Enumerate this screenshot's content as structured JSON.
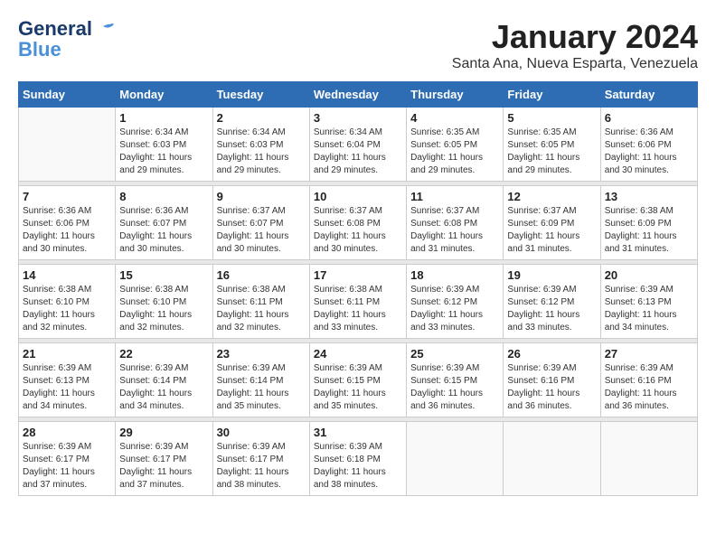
{
  "logo": {
    "line1": "General",
    "line2": "Blue"
  },
  "title": "January 2024",
  "subtitle": "Santa Ana, Nueva Esparta, Venezuela",
  "days_of_week": [
    "Sunday",
    "Monday",
    "Tuesday",
    "Wednesday",
    "Thursday",
    "Friday",
    "Saturday"
  ],
  "weeks": [
    [
      {
        "day": "",
        "info": ""
      },
      {
        "day": "1",
        "info": "Sunrise: 6:34 AM\nSunset: 6:03 PM\nDaylight: 11 hours\nand 29 minutes."
      },
      {
        "day": "2",
        "info": "Sunrise: 6:34 AM\nSunset: 6:03 PM\nDaylight: 11 hours\nand 29 minutes."
      },
      {
        "day": "3",
        "info": "Sunrise: 6:34 AM\nSunset: 6:04 PM\nDaylight: 11 hours\nand 29 minutes."
      },
      {
        "day": "4",
        "info": "Sunrise: 6:35 AM\nSunset: 6:05 PM\nDaylight: 11 hours\nand 29 minutes."
      },
      {
        "day": "5",
        "info": "Sunrise: 6:35 AM\nSunset: 6:05 PM\nDaylight: 11 hours\nand 29 minutes."
      },
      {
        "day": "6",
        "info": "Sunrise: 6:36 AM\nSunset: 6:06 PM\nDaylight: 11 hours\nand 30 minutes."
      }
    ],
    [
      {
        "day": "7",
        "info": "Sunrise: 6:36 AM\nSunset: 6:06 PM\nDaylight: 11 hours\nand 30 minutes."
      },
      {
        "day": "8",
        "info": "Sunrise: 6:36 AM\nSunset: 6:07 PM\nDaylight: 11 hours\nand 30 minutes."
      },
      {
        "day": "9",
        "info": "Sunrise: 6:37 AM\nSunset: 6:07 PM\nDaylight: 11 hours\nand 30 minutes."
      },
      {
        "day": "10",
        "info": "Sunrise: 6:37 AM\nSunset: 6:08 PM\nDaylight: 11 hours\nand 30 minutes."
      },
      {
        "day": "11",
        "info": "Sunrise: 6:37 AM\nSunset: 6:08 PM\nDaylight: 11 hours\nand 31 minutes."
      },
      {
        "day": "12",
        "info": "Sunrise: 6:37 AM\nSunset: 6:09 PM\nDaylight: 11 hours\nand 31 minutes."
      },
      {
        "day": "13",
        "info": "Sunrise: 6:38 AM\nSunset: 6:09 PM\nDaylight: 11 hours\nand 31 minutes."
      }
    ],
    [
      {
        "day": "14",
        "info": "Sunrise: 6:38 AM\nSunset: 6:10 PM\nDaylight: 11 hours\nand 32 minutes."
      },
      {
        "day": "15",
        "info": "Sunrise: 6:38 AM\nSunset: 6:10 PM\nDaylight: 11 hours\nand 32 minutes."
      },
      {
        "day": "16",
        "info": "Sunrise: 6:38 AM\nSunset: 6:11 PM\nDaylight: 11 hours\nand 32 minutes."
      },
      {
        "day": "17",
        "info": "Sunrise: 6:38 AM\nSunset: 6:11 PM\nDaylight: 11 hours\nand 33 minutes."
      },
      {
        "day": "18",
        "info": "Sunrise: 6:39 AM\nSunset: 6:12 PM\nDaylight: 11 hours\nand 33 minutes."
      },
      {
        "day": "19",
        "info": "Sunrise: 6:39 AM\nSunset: 6:12 PM\nDaylight: 11 hours\nand 33 minutes."
      },
      {
        "day": "20",
        "info": "Sunrise: 6:39 AM\nSunset: 6:13 PM\nDaylight: 11 hours\nand 34 minutes."
      }
    ],
    [
      {
        "day": "21",
        "info": "Sunrise: 6:39 AM\nSunset: 6:13 PM\nDaylight: 11 hours\nand 34 minutes."
      },
      {
        "day": "22",
        "info": "Sunrise: 6:39 AM\nSunset: 6:14 PM\nDaylight: 11 hours\nand 34 minutes."
      },
      {
        "day": "23",
        "info": "Sunrise: 6:39 AM\nSunset: 6:14 PM\nDaylight: 11 hours\nand 35 minutes."
      },
      {
        "day": "24",
        "info": "Sunrise: 6:39 AM\nSunset: 6:15 PM\nDaylight: 11 hours\nand 35 minutes."
      },
      {
        "day": "25",
        "info": "Sunrise: 6:39 AM\nSunset: 6:15 PM\nDaylight: 11 hours\nand 36 minutes."
      },
      {
        "day": "26",
        "info": "Sunrise: 6:39 AM\nSunset: 6:16 PM\nDaylight: 11 hours\nand 36 minutes."
      },
      {
        "day": "27",
        "info": "Sunrise: 6:39 AM\nSunset: 6:16 PM\nDaylight: 11 hours\nand 36 minutes."
      }
    ],
    [
      {
        "day": "28",
        "info": "Sunrise: 6:39 AM\nSunset: 6:17 PM\nDaylight: 11 hours\nand 37 minutes."
      },
      {
        "day": "29",
        "info": "Sunrise: 6:39 AM\nSunset: 6:17 PM\nDaylight: 11 hours\nand 37 minutes."
      },
      {
        "day": "30",
        "info": "Sunrise: 6:39 AM\nSunset: 6:17 PM\nDaylight: 11 hours\nand 38 minutes."
      },
      {
        "day": "31",
        "info": "Sunrise: 6:39 AM\nSunset: 6:18 PM\nDaylight: 11 hours\nand 38 minutes."
      },
      {
        "day": "",
        "info": ""
      },
      {
        "day": "",
        "info": ""
      },
      {
        "day": "",
        "info": ""
      }
    ]
  ]
}
